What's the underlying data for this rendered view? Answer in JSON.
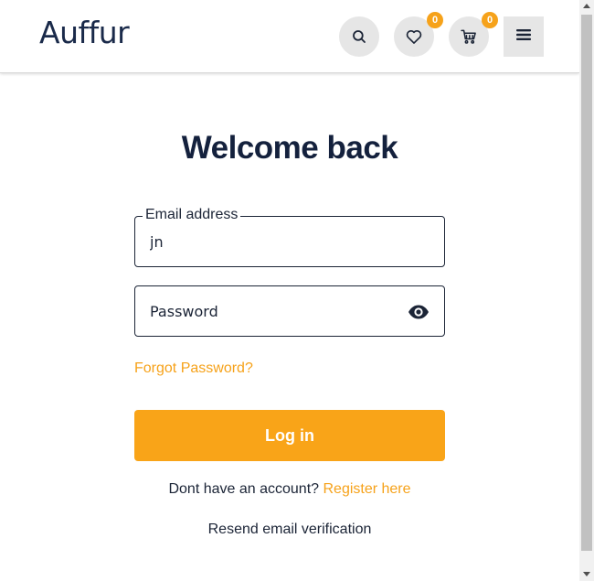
{
  "header": {
    "logo": "Auffur",
    "wishlist_count": "0",
    "cart_count": "0"
  },
  "form": {
    "title": "Welcome back",
    "email_label": "Email address",
    "email_value": "jn",
    "password_placeholder": "Password",
    "forgot_password": "Forgot Password?",
    "login_button": "Log in",
    "no_account_text": "Dont have an account?",
    "register_link": "Register here",
    "resend_verification": "Resend email verification"
  },
  "colors": {
    "accent": "#f9a418",
    "heading": "#14213d"
  },
  "icons": [
    "search-icon",
    "heart-icon",
    "cart-icon",
    "menu-icon",
    "eye-icon"
  ]
}
